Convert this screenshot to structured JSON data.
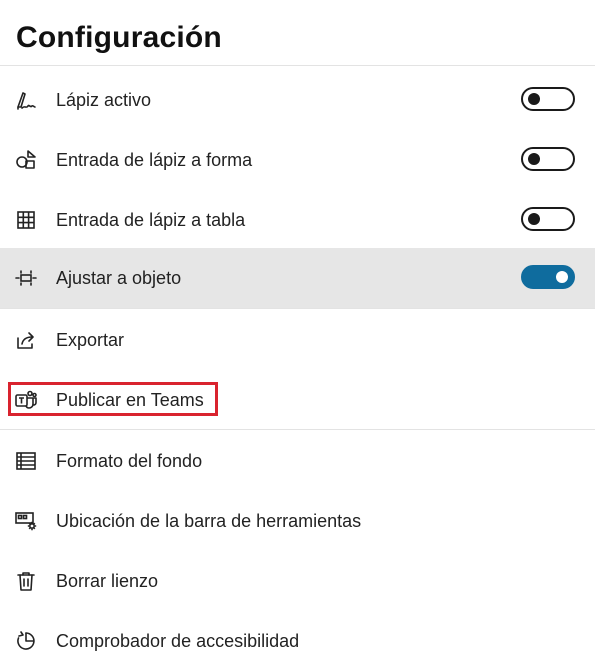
{
  "header": {
    "title": "Configuración"
  },
  "items": [
    {
      "label": "Lápiz activo",
      "icon": "pen-icon",
      "toggle": "off"
    },
    {
      "label": "Entrada de lápiz a forma",
      "icon": "shapes-icon",
      "toggle": "off"
    },
    {
      "label": "Entrada de lápiz a tabla",
      "icon": "table-grid-icon",
      "toggle": "off"
    },
    {
      "label": "Ajustar a objeto",
      "icon": "snap-align-icon",
      "toggle": "on"
    },
    {
      "label": "Exportar",
      "icon": "share-export-icon"
    },
    {
      "label": "Publicar en Teams",
      "icon": "teams-icon"
    },
    {
      "label": "Formato del fondo",
      "icon": "background-format-icon"
    },
    {
      "label": "Ubicación de la barra de herramientas",
      "icon": "toolbar-settings-icon"
    },
    {
      "label": "Borrar lienzo",
      "icon": "trash-icon"
    },
    {
      "label": "Comprobador de accesibilidad",
      "icon": "accessibility-checker-icon"
    }
  ],
  "colors": {
    "toggle_on": "#0f6c9e",
    "selected_row": "#e6e6e6",
    "highlight_box": "#d9232e"
  }
}
